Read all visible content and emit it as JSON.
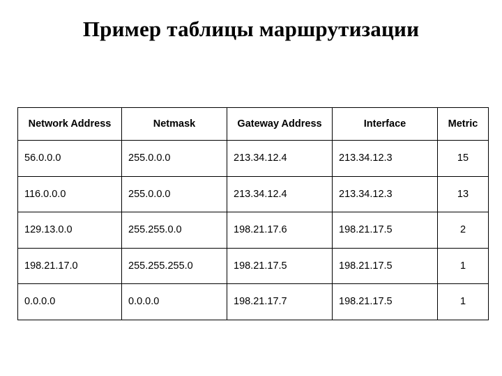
{
  "slide": {
    "title": "Пример таблицы маршрутизации",
    "background_color": "#ffffff",
    "text_color": "#000000",
    "border_color": "#000000"
  },
  "table": {
    "columns": [
      {
        "key": "network",
        "label": "Network Address",
        "align": "left"
      },
      {
        "key": "netmask",
        "label": "Netmask",
        "align": "left"
      },
      {
        "key": "gateway",
        "label": "Gateway Address",
        "align": "left"
      },
      {
        "key": "interface",
        "label": "Interface",
        "align": "left"
      },
      {
        "key": "metric",
        "label": "Metric",
        "align": "center"
      }
    ],
    "rows": [
      {
        "network": "56.0.0.0",
        "netmask": "255.0.0.0",
        "gateway": "213.34.12.4",
        "interface": "213.34.12.3",
        "metric": "15"
      },
      {
        "network": "116.0.0.0",
        "netmask": "255.0.0.0",
        "gateway": "213.34.12.4",
        "interface": "213.34.12.3",
        "metric": "13"
      },
      {
        "network": "129.13.0.0",
        "netmask": "255.255.0.0",
        "gateway": "198.21.17.6",
        "interface": "198.21.17.5",
        "metric": "2"
      },
      {
        "network": "198.21.17.0",
        "netmask": "255.255.255.0",
        "gateway": "198.21.17.5",
        "interface": "198.21.17.5",
        "metric": "1"
      },
      {
        "network": "0.0.0.0",
        "netmask": "0.0.0.0",
        "gateway": "198.21.17.7",
        "interface": "198.21.17.5",
        "metric": "1"
      }
    ]
  }
}
